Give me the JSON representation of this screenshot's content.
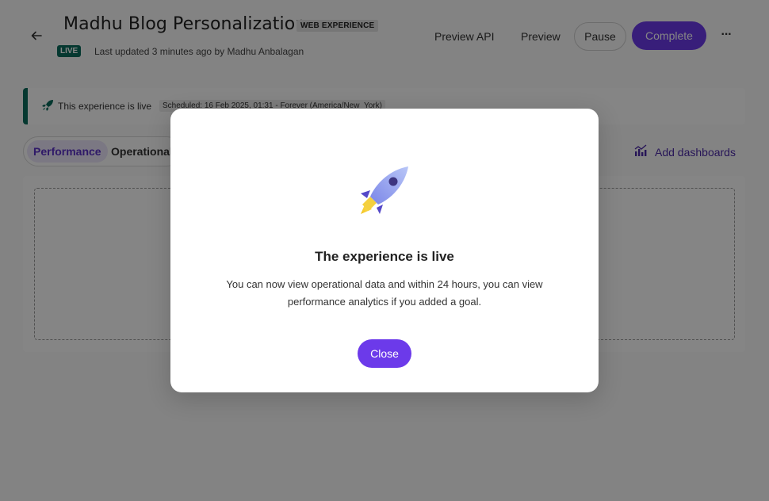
{
  "header": {
    "title": "Madhu Blog Personalization",
    "type_badge": "WEB EXPERIENCE",
    "status_badge": "LIVE",
    "last_updated": "Last updated 3 minutes ago by Madhu Anbalagan",
    "actions": {
      "preview_api": "Preview API",
      "preview": "Preview",
      "pause": "Pause",
      "complete": "Complete",
      "more": "···"
    }
  },
  "banner": {
    "text": "This experience is live",
    "schedule": "Scheduled: 16 Feb 2025, 01:31 - Forever (America/New_York)"
  },
  "tabs": [
    {
      "label": "Performance",
      "active": true
    },
    {
      "label": "Operational",
      "active": false
    }
  ],
  "add_dashboards": "Add dashboards",
  "modal": {
    "title": "The experience is live",
    "body": "You can now view operational data and within 24 hours, you can view performance analytics if you added a goal.",
    "close": "Close"
  },
  "colors": {
    "accent": "#6c3aea",
    "live": "#0b6b5d",
    "overlay": "rgba(0,0,0,0.48)"
  },
  "icons": {
    "back": "arrow-left-icon",
    "banner": "rocket-icon",
    "dashboards": "chart-icon",
    "modal": "rocket-illustration"
  }
}
